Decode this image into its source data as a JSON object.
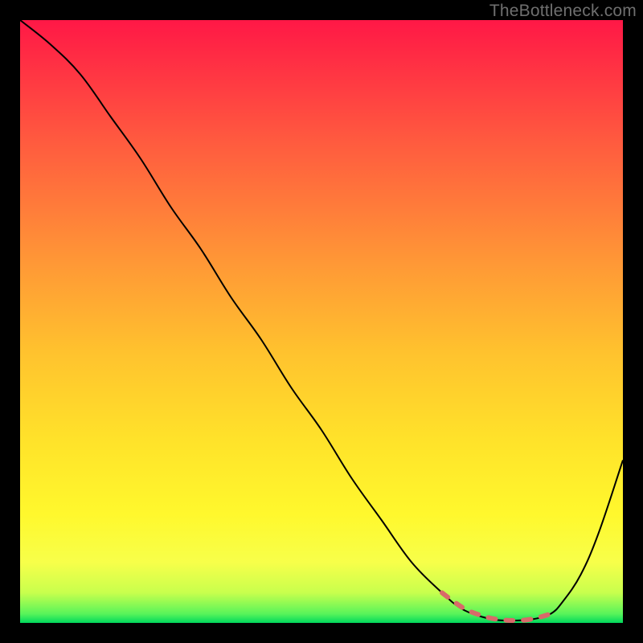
{
  "watermark": "TheBottleneck.com",
  "chart_data": {
    "type": "line",
    "title": "",
    "xlabel": "",
    "ylabel": "",
    "xlim": [
      0,
      100
    ],
    "ylim": [
      0,
      100
    ],
    "grid": false,
    "legend": false,
    "series": [
      {
        "name": "primary-curve",
        "color": "#000000",
        "x": [
          0,
          5,
          10,
          15,
          20,
          25,
          30,
          35,
          40,
          45,
          50,
          55,
          60,
          65,
          70,
          73,
          76,
          79,
          82,
          85,
          88,
          90,
          93,
          96,
          100
        ],
        "y": [
          100,
          96,
          91,
          84,
          77,
          69,
          62,
          54,
          47,
          39,
          32,
          24,
          17,
          10,
          5,
          2.5,
          1.2,
          0.5,
          0.4,
          0.6,
          1.5,
          3.5,
          8,
          15,
          27
        ]
      },
      {
        "name": "highlight-segment",
        "color": "#d86a69",
        "dashed": true,
        "x": [
          70,
          72,
          74,
          76,
          78,
          80,
          82,
          84,
          86,
          88
        ],
        "y": [
          5,
          3.5,
          2.2,
          1.4,
          0.8,
          0.5,
          0.4,
          0.5,
          0.9,
          1.5
        ]
      }
    ],
    "background": {
      "type": "vertical-gradient",
      "stops": [
        {
          "pos": 0.0,
          "color": "#ff1846"
        },
        {
          "pos": 0.2,
          "color": "#ff5a3f"
        },
        {
          "pos": 0.4,
          "color": "#ff9736"
        },
        {
          "pos": 0.55,
          "color": "#ffc22e"
        },
        {
          "pos": 0.7,
          "color": "#ffe32a"
        },
        {
          "pos": 0.82,
          "color": "#fff82d"
        },
        {
          "pos": 0.9,
          "color": "#f7ff4a"
        },
        {
          "pos": 0.95,
          "color": "#c8ff4d"
        },
        {
          "pos": 0.985,
          "color": "#58f45a"
        },
        {
          "pos": 1.0,
          "color": "#00d85c"
        }
      ]
    }
  }
}
